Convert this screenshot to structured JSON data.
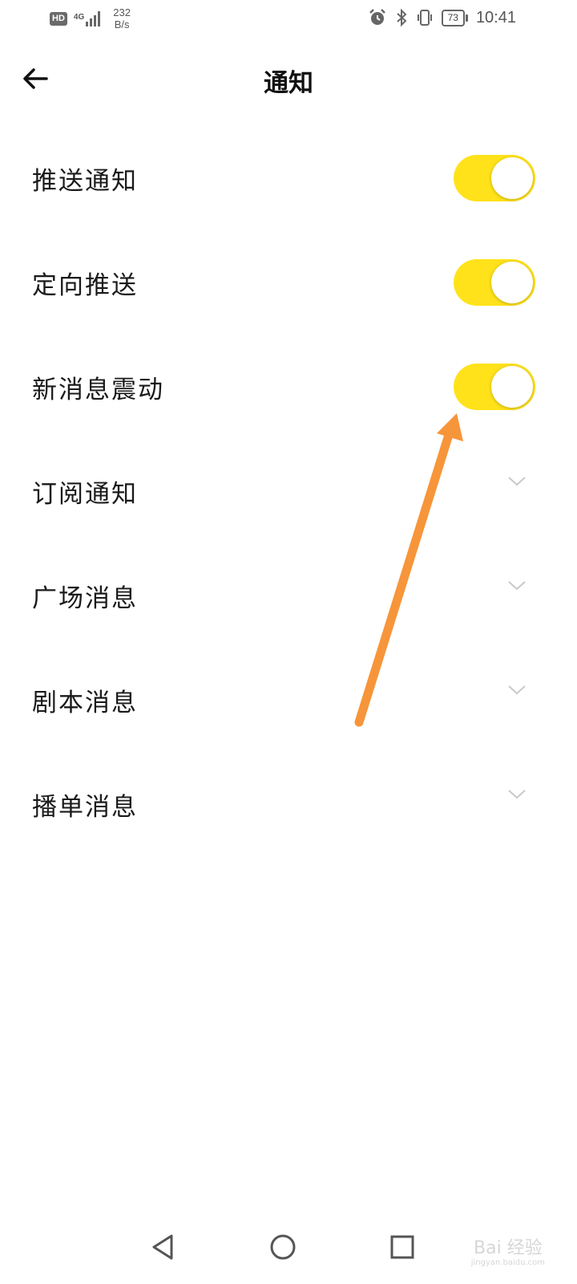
{
  "status_bar": {
    "hd": "HD",
    "network": "4G",
    "speed_value": "232",
    "speed_unit": "B/s",
    "battery": "73",
    "time": "10:41",
    "icons": [
      "alarm-icon",
      "bluetooth-icon",
      "vibrate-icon",
      "battery-icon",
      "signal-icon"
    ]
  },
  "header": {
    "title": "通知",
    "back_icon": "back-arrow-icon"
  },
  "settings": {
    "push": {
      "label": "推送通知",
      "on": true
    },
    "targeted": {
      "label": "定向推送",
      "on": true
    },
    "vibrate": {
      "label": "新消息震动",
      "on": true
    },
    "subscription": {
      "label": "订阅通知"
    },
    "square": {
      "label": "广场消息"
    },
    "script": {
      "label": "剧本消息"
    },
    "playlist": {
      "label": "播单消息"
    }
  },
  "colors": {
    "toggle_on": "#ffe21a",
    "annotation_arrow": "#f7953a"
  },
  "watermark": {
    "brand": "Bai 经验",
    "url": "jingyan.baidu.com"
  }
}
